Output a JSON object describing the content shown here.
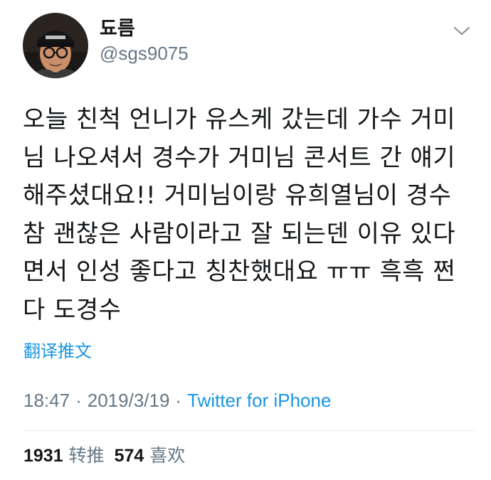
{
  "user": {
    "display_name": "됴름",
    "handle": "@sgs9075",
    "avatar_icon": "avatar-photo"
  },
  "menu": {
    "icon": "chevron-down-icon"
  },
  "tweet": {
    "lines": [
      "오늘 친척 언니가 유스케 갔는데 가수 거미",
      "님 나오셔서 경수가 거미님 콘서트 간 얘기",
      "해주셨대요!! 거미님이랑 유희열님이 경수",
      "참 괜찮은 사람이라고 잘 되는덴 이유 있다",
      "면서 인성 좋다고 칭찬했대요 ㅠㅠ 흑흑 쩐",
      "다 도경수"
    ]
  },
  "translate_label": "翻译推文",
  "meta": {
    "time": "18:47",
    "separator": "·",
    "date": "2019/3/19",
    "source": "Twitter for iPhone"
  },
  "stats": {
    "retweets_count": "1931",
    "retweets_label": "转推",
    "likes_count": "574",
    "likes_label": "喜欢"
  },
  "colors": {
    "text_primary": "#14171a",
    "text_secondary": "#657786",
    "link_blue": "#1b95e0",
    "divider": "#e1e8ed"
  }
}
